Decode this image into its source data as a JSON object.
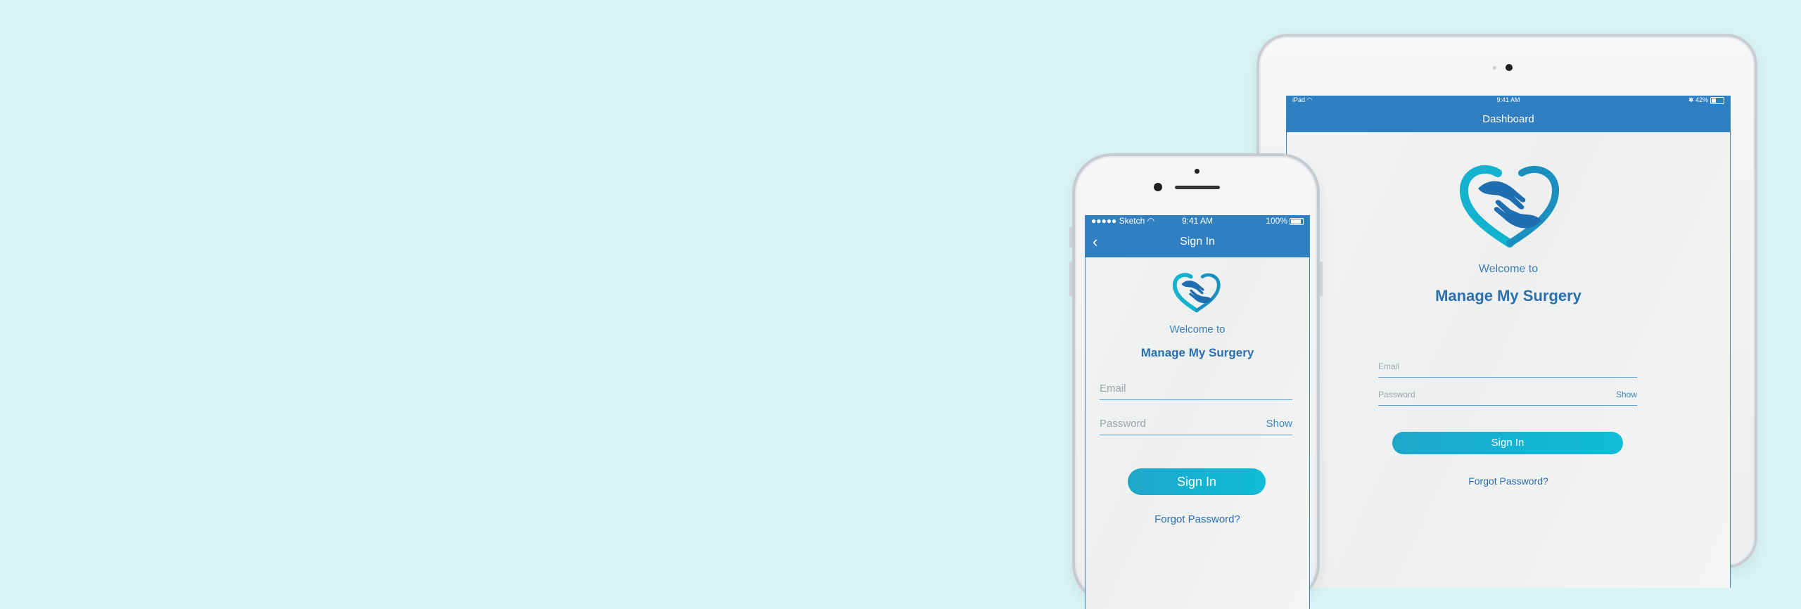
{
  "ipad": {
    "status": {
      "carrier": "iPad",
      "time": "9:41 AM",
      "battery": "42%"
    },
    "nav_title": "Dashboard",
    "welcome": "Welcome to",
    "brand": "Manage My Surgery",
    "email_placeholder": "Email",
    "password_placeholder": "Password",
    "show_label": "Show",
    "signin_label": "Sign In",
    "forgot_label": "Forgot Password?"
  },
  "iphone": {
    "status": {
      "carrier": "●●●●● Sketch",
      "time": "9:41 AM",
      "battery": "100%"
    },
    "nav_title": "Sign In",
    "welcome": "Welcome to",
    "brand": "Manage My Surgery",
    "email_placeholder": "Email",
    "password_placeholder": "Password",
    "show_label": "Show",
    "signin_label": "Sign In",
    "forgot_label": "Forgot Password?"
  },
  "colors": {
    "background": "#daf4f6",
    "primary": "#2f7fc1",
    "accent": "#14b4d3"
  }
}
